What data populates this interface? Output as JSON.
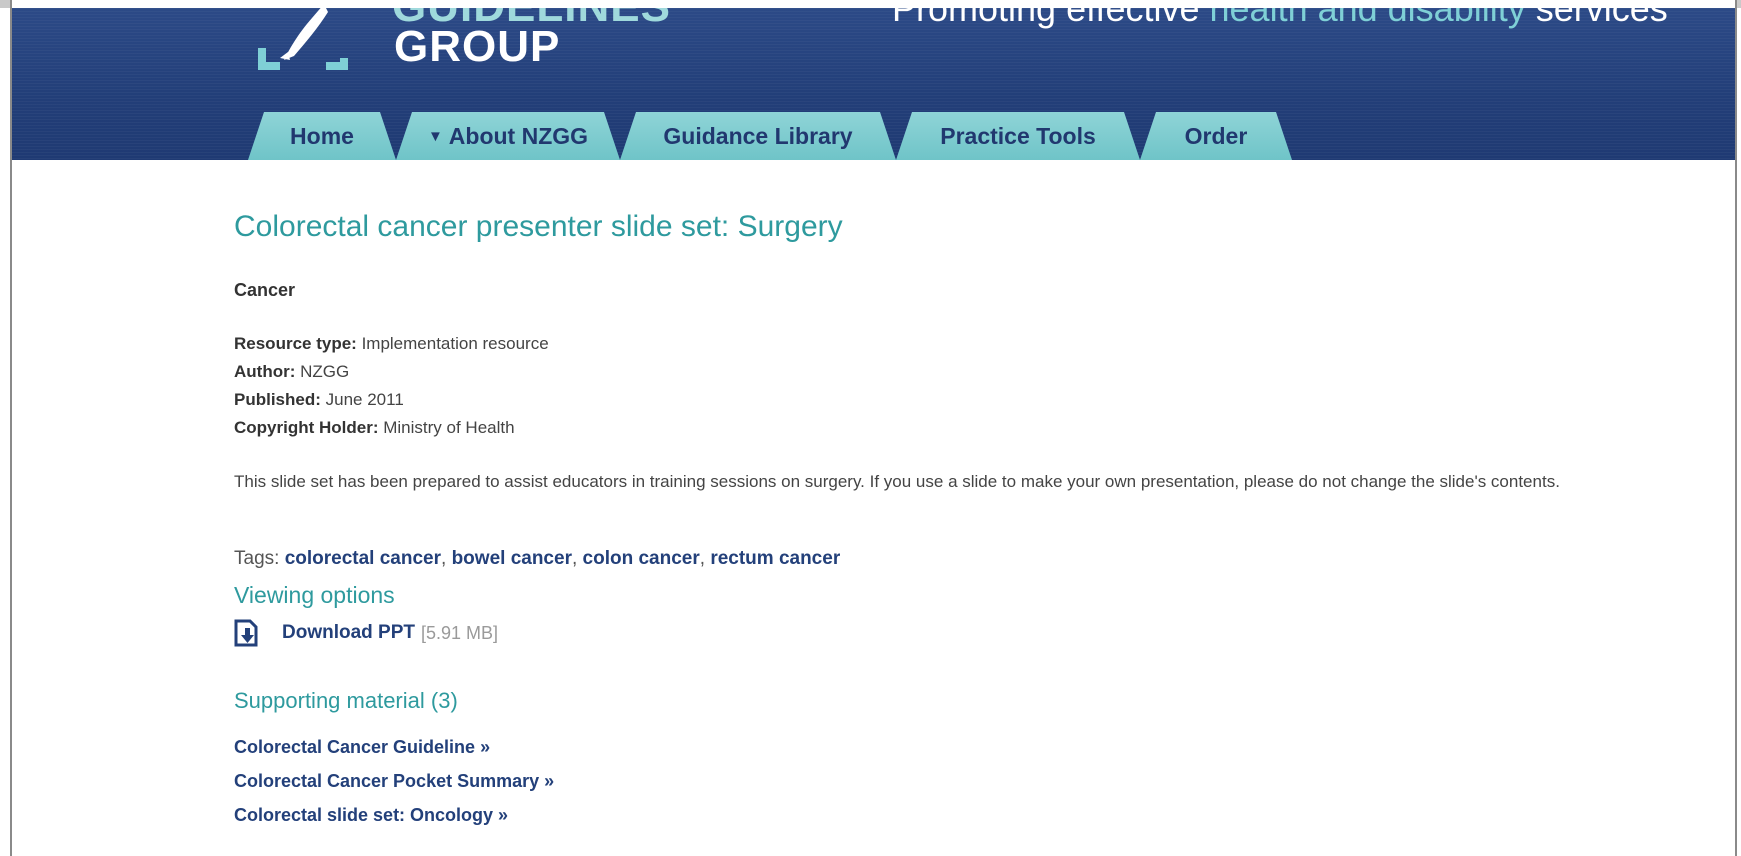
{
  "header": {
    "logo_top_text": "GUIDELINES",
    "logo_group_text": "GROUP",
    "tagline_prefix": "Promoting effective ",
    "tagline_highlight": "health and disability",
    "tagline_suffix": " services"
  },
  "nav": {
    "tabs": [
      {
        "label": "Home"
      },
      {
        "label": "About NZGG",
        "has_dropdown": true
      },
      {
        "label": "Guidance Library"
      },
      {
        "label": "Practice Tools"
      },
      {
        "label": "Order"
      }
    ]
  },
  "page": {
    "title": "Colorectal cancer presenter slide set: Surgery",
    "category": "Cancer",
    "meta": {
      "resource_type_label": "Resource type:",
      "resource_type_value": "Implementation resource",
      "author_label": "Author:",
      "author_value": "NZGG",
      "published_label": "Published:",
      "published_value": "June 2011",
      "copyright_label": "Copyright Holder:",
      "copyright_value": "Ministry of Health"
    },
    "description": "This slide set has been prepared to assist educators in training sessions on surgery.  If you use a slide to make your own presentation, please do not change the slide's contents.",
    "tags_label": "Tags:",
    "tags": [
      "colorectal cancer",
      "bowel cancer",
      "colon cancer",
      "rectum cancer"
    ],
    "viewing_options_title": "Viewing options",
    "download": {
      "label": "Download PPT",
      "size": "[5.91 MB]"
    },
    "supporting_title": "Supporting material (3)",
    "supporting_items": [
      "Colorectal Cancer Guideline »",
      "Colorectal Cancer Pocket Summary »",
      "Colorectal slide set: Oncology »"
    ]
  },
  "colors": {
    "header_blue": "#223e78",
    "tab_teal": "#7fcbce",
    "heading_teal": "#2e9a9e",
    "link_navy": "#23407a"
  }
}
